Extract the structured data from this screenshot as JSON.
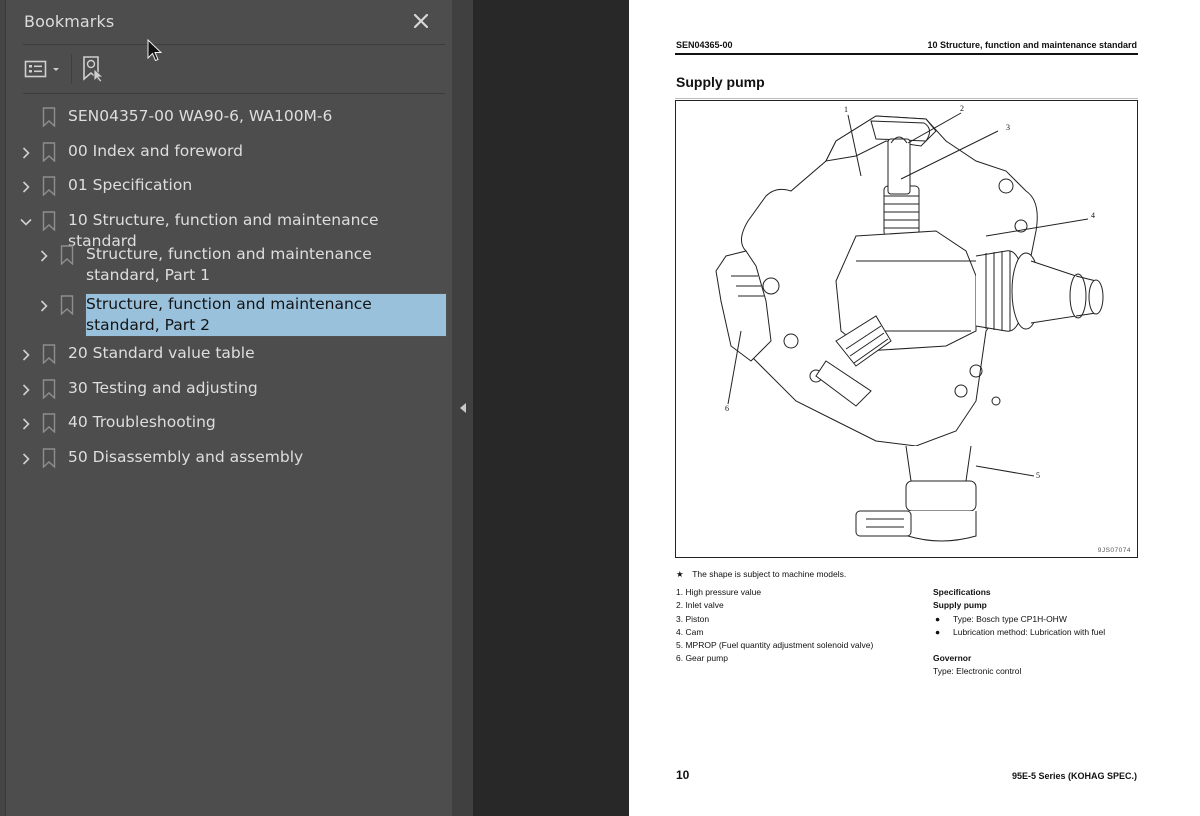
{
  "bookmarks_panel": {
    "title": "Bookmarks",
    "close_icon": "close-icon",
    "toolbar": {
      "options_icon": "list-options-icon",
      "options_dropdown_icon": "caret-down-icon",
      "find_bookmark_icon": "bookmark-find-icon"
    },
    "items": [
      {
        "label": "SEN04357-00 WA90-6, WA100M-6",
        "level": 0,
        "expandable": false,
        "expanded": false,
        "selected": false
      },
      {
        "label": "00 Index and foreword",
        "level": 0,
        "expandable": true,
        "expanded": false,
        "selected": false
      },
      {
        "label": "01 Specification",
        "level": 0,
        "expandable": true,
        "expanded": false,
        "selected": false
      },
      {
        "label": "10 Structure, function and maintenance standard",
        "level": 0,
        "expandable": true,
        "expanded": true,
        "selected": false
      },
      {
        "label": "Structure, function and maintenance standard, Part 1",
        "level": 1,
        "expandable": true,
        "expanded": false,
        "selected": false
      },
      {
        "label": "Structure, function and maintenance standard, Part 2",
        "level": 1,
        "expandable": true,
        "expanded": false,
        "selected": true
      },
      {
        "label": "20 Standard value table",
        "level": 0,
        "expandable": true,
        "expanded": false,
        "selected": false
      },
      {
        "label": "30 Testing and adjusting",
        "level": 0,
        "expandable": true,
        "expanded": false,
        "selected": false
      },
      {
        "label": "40 Troubleshooting",
        "level": 0,
        "expandable": true,
        "expanded": false,
        "selected": false
      },
      {
        "label": "50 Disassembly and assembly",
        "level": 0,
        "expandable": true,
        "expanded": false,
        "selected": false
      }
    ],
    "selection_color": "#9ac1dc"
  },
  "splitter": {
    "collapse_icon": "triangle-left-icon"
  },
  "document_page": {
    "header_left": "SEN04365-00",
    "header_right": "10 Structure, function and maintenance standard",
    "title": "Supply pump",
    "figure": {
      "code": "9JS07074",
      "callouts": [
        "1",
        "2",
        "3",
        "4",
        "5",
        "6"
      ],
      "subject": "supply-pump-illustration"
    },
    "note_symbol": "★",
    "note": "The shape is subject to machine models.",
    "parts": [
      "1.  High pressure value",
      "2.  Inlet valve",
      "3.  Piston",
      "4.  Cam",
      "5.  MPROP (Fuel quantity adjustment solenoid valve)",
      "6.  Gear pump"
    ],
    "specifications": {
      "heading": "Specifications",
      "supply_pump_heading": "Supply pump",
      "supply_pump_items": [
        "Type: Bosch type CP1H-OHW",
        "Lubrication method: Lubrication with fuel"
      ],
      "governor_heading": "Governor",
      "governor_type": "Type: Electronic control"
    },
    "footer_page_number": "10",
    "footer_right": "95E-5 Series (KOHAG SPEC.)"
  }
}
